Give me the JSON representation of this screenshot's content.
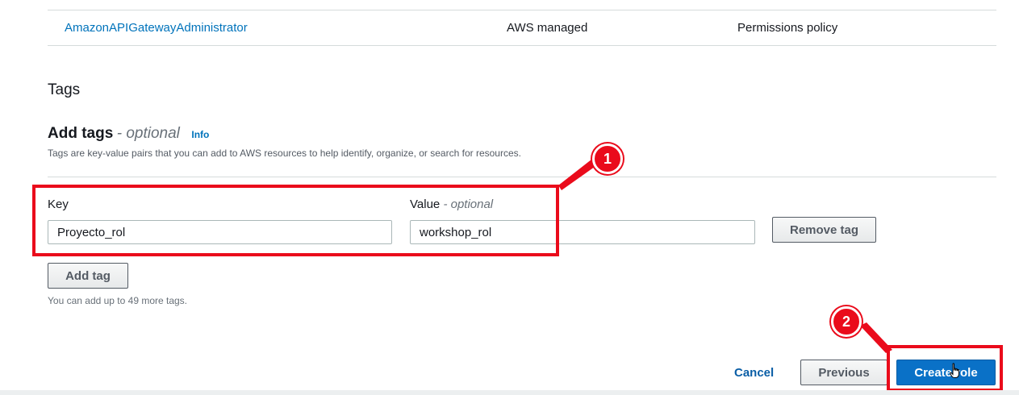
{
  "policies_table": {
    "row": {
      "policy_name": "AmazonAPIGatewayAdministrator",
      "type": "AWS managed",
      "used_as": "Permissions policy"
    }
  },
  "tags_section": {
    "heading": "Tags",
    "add_tags_title": "Add tags",
    "optional_suffix": "- optional",
    "info_link": "Info",
    "description": "Tags are key-value pairs that you can add to AWS resources to help identify, organize, or search for resources.",
    "key_label": "Key",
    "value_label": "Value",
    "value_optional": "- optional",
    "tag": {
      "key": "Proyecto_rol",
      "value": "workshop_rol"
    },
    "remove_tag_button": "Remove tag",
    "add_tag_button": "Add tag",
    "hint": "You can add up to 49 more tags."
  },
  "footer": {
    "cancel": "Cancel",
    "previous": "Previous",
    "create_role": "Create role"
  },
  "annotations": {
    "badge_1": "1",
    "badge_2": "2",
    "color": "#ea0b1b"
  },
  "icons": {
    "cursor": "hand-pointer-cursor-icon"
  }
}
